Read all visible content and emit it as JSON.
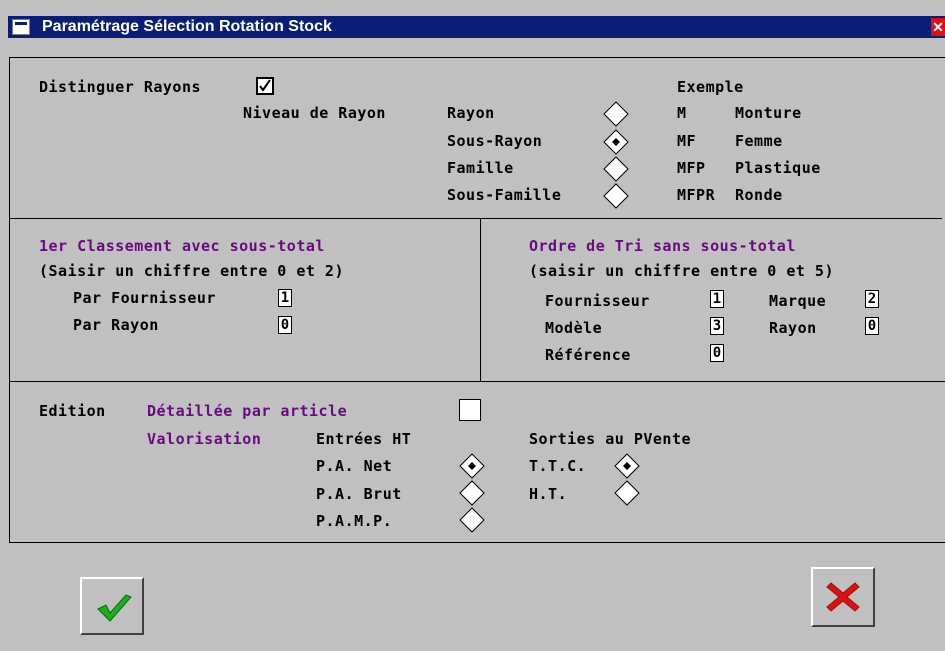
{
  "window": {
    "title": "Paramétrage Sélection Rotation Stock",
    "close_glyph": "✕"
  },
  "rayons": {
    "distinguer_label": "Distinguer Rayons",
    "distinguer_checked": true,
    "niveau_label": "Niveau de Rayon",
    "exemple_header": "Exemple",
    "options": [
      {
        "label": "Rayon",
        "selected": false,
        "code": "M",
        "example": "Monture"
      },
      {
        "label": "Sous-Rayon",
        "selected": true,
        "code": "MF",
        "example": "Femme"
      },
      {
        "label": "Famille",
        "selected": false,
        "code": "MFP",
        "example": "Plastique"
      },
      {
        "label": "Sous-Famille",
        "selected": false,
        "code": "MFPR",
        "example": "Ronde"
      }
    ]
  },
  "classement": {
    "title": "1er Classement avec sous-total",
    "hint": "(Saisir un chiffre entre 0 et 2)",
    "par_fournisseur_label": "Par Fournisseur",
    "par_fournisseur_value": "1",
    "par_rayon_label": "Par Rayon",
    "par_rayon_value": "0"
  },
  "tri": {
    "title": "Ordre de Tri sans sous-total",
    "hint": "(saisir un chiffre entre 0 et 5)",
    "fournisseur_label": "Fournisseur",
    "fournisseur_value": "1",
    "marque_label": "Marque",
    "marque_value": "2",
    "modele_label": "Modèle",
    "modele_value": "3",
    "rayon_label": "Rayon",
    "rayon_value": "0",
    "reference_label": "Référence",
    "reference_value": "0"
  },
  "edition": {
    "label": "Edition",
    "detaillee_label": "Détaillée par article",
    "detaillee_checked": false,
    "valorisation_label": "Valorisation",
    "entrees_header": "Entrées HT",
    "entrees_options": [
      {
        "label": "P.A. Net",
        "selected": true
      },
      {
        "label": "P.A. Brut",
        "selected": false
      },
      {
        "label": "P.A.M.P.",
        "selected": false
      }
    ],
    "sorties_header": "Sorties au PVente",
    "sorties_options": [
      {
        "label": "T.T.C.",
        "selected": true
      },
      {
        "label": "H.T.",
        "selected": false
      }
    ]
  },
  "buttons": {
    "ok_icon": "green-checkmark-icon",
    "cancel_icon": "red-cross-icon"
  },
  "colors": {
    "title_bar": "#0a1e78",
    "section_label": "#6a0a80",
    "background": "#c0c0c0",
    "ok": "#19b019",
    "cancel": "#e01010"
  }
}
